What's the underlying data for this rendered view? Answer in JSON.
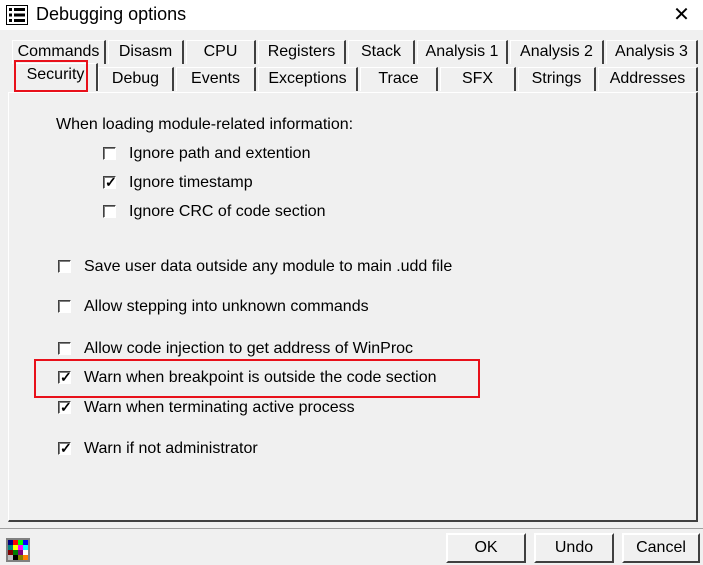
{
  "window": {
    "title": "Debugging options",
    "close_glyph": "✕"
  },
  "tabs_row1": [
    "Commands",
    "Disasm",
    "CPU",
    "Registers",
    "Stack",
    "Analysis 1",
    "Analysis 2",
    "Analysis 3"
  ],
  "tabs_row2": [
    "Security",
    "Debug",
    "Events",
    "Exceptions",
    "Trace",
    "SFX",
    "Strings",
    "Addresses"
  ],
  "active_tab": "Security",
  "section_label": "When loading module-related information:",
  "module_options": [
    {
      "label": "Ignore path and extention",
      "checked": false
    },
    {
      "label": "Ignore timestamp",
      "checked": true
    },
    {
      "label": "Ignore CRC of code section",
      "checked": false
    }
  ],
  "options": [
    {
      "label": "Save user data outside any module to main .udd file",
      "checked": false
    },
    {
      "label": "Allow stepping into unknown commands",
      "checked": false
    },
    {
      "label": "Allow code injection to get address of WinProc",
      "checked": false
    },
    {
      "label": "Warn when breakpoint is outside the code section",
      "checked": true
    },
    {
      "label": "Warn when terminating active process",
      "checked": true
    },
    {
      "label": "Warn if not administrator",
      "checked": true
    }
  ],
  "buttons": {
    "ok": "OK",
    "undo": "Undo",
    "cancel": "Cancel"
  },
  "icons": {
    "app": "list-icon",
    "palette": "color-palette-icon",
    "close": "close-icon"
  },
  "colors": {
    "highlight": "#e8101a"
  }
}
